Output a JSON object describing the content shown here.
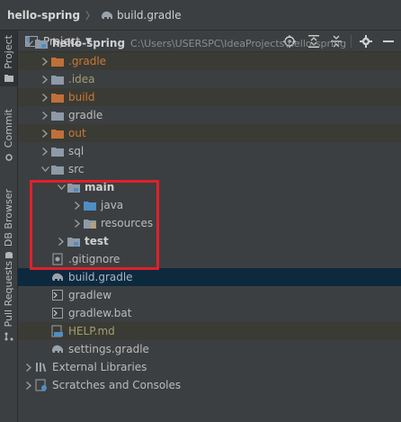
{
  "breadcrumb": {
    "project": "hello-spring",
    "separator": "〉",
    "file": "build.gradle"
  },
  "side_tabs": [
    {
      "label": "Project"
    },
    {
      "label": "Commit"
    },
    {
      "label": "DB Browser"
    },
    {
      "label": "Pull Requests"
    }
  ],
  "toolbar": {
    "view_label": "Project",
    "caret": "▼",
    "icons": [
      "locate-icon",
      "expand-all-icon",
      "collapse-all-icon",
      "gear-icon",
      "hide-icon"
    ]
  },
  "tree": {
    "root": {
      "label": "hello-spring",
      "path": "C:\\Users\\USERSPC\\IdeaProjects\\hello-spring"
    },
    "items": [
      {
        "label": ".gradle"
      },
      {
        "label": ".idea"
      },
      {
        "label": "build"
      },
      {
        "label": "gradle"
      },
      {
        "label": "out"
      },
      {
        "label": "sql"
      },
      {
        "label": "src"
      },
      {
        "label": "main"
      },
      {
        "label": "java"
      },
      {
        "label": "resources"
      },
      {
        "label": "test"
      },
      {
        "label": ".gitignore"
      },
      {
        "label": "build.gradle"
      },
      {
        "label": "gradlew"
      },
      {
        "label": "gradlew.bat"
      },
      {
        "label": "HELP.md"
      },
      {
        "label": "settings.gradle"
      },
      {
        "label": "External Libraries"
      },
      {
        "label": "Scratches and Consoles"
      }
    ]
  },
  "colors": {
    "excluded_folder": "#cc7832",
    "selected_row": "#0d293e",
    "annotation_box": "#e0202a"
  }
}
